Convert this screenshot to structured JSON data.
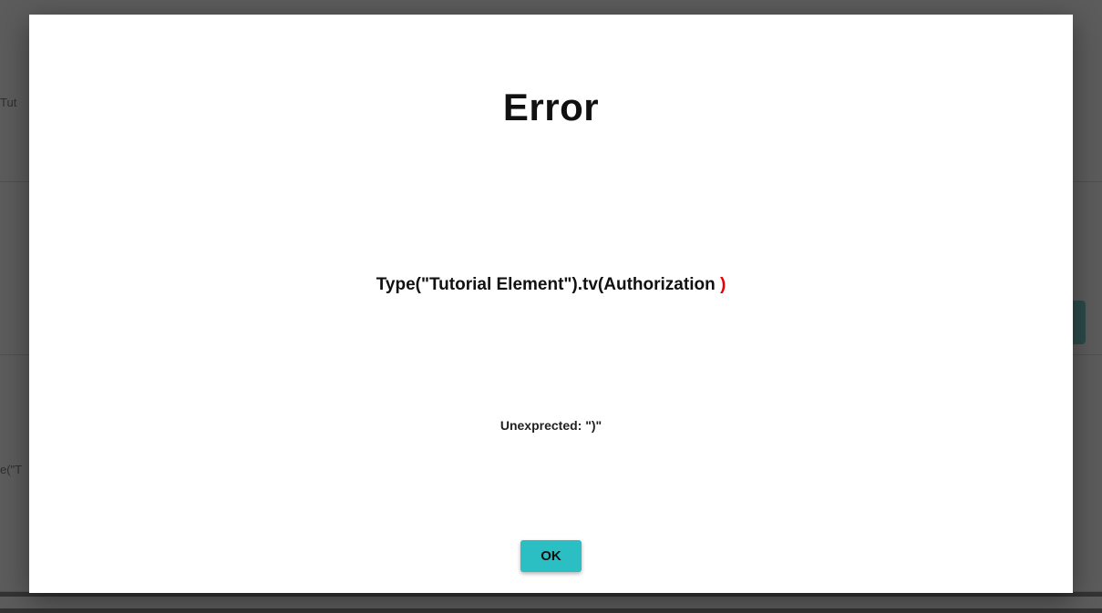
{
  "background": {
    "hint1": "Tut",
    "hint2": "e(\"T"
  },
  "modal": {
    "title": "Error",
    "expression_main": "Type(\"Tutorial Element\").tv(Authorization ",
    "expression_error_token": ")",
    "message": "Unexprected: \")\"",
    "ok_label": "OK"
  },
  "colors": {
    "accent": "#2bbec2",
    "error": "#e80000"
  }
}
